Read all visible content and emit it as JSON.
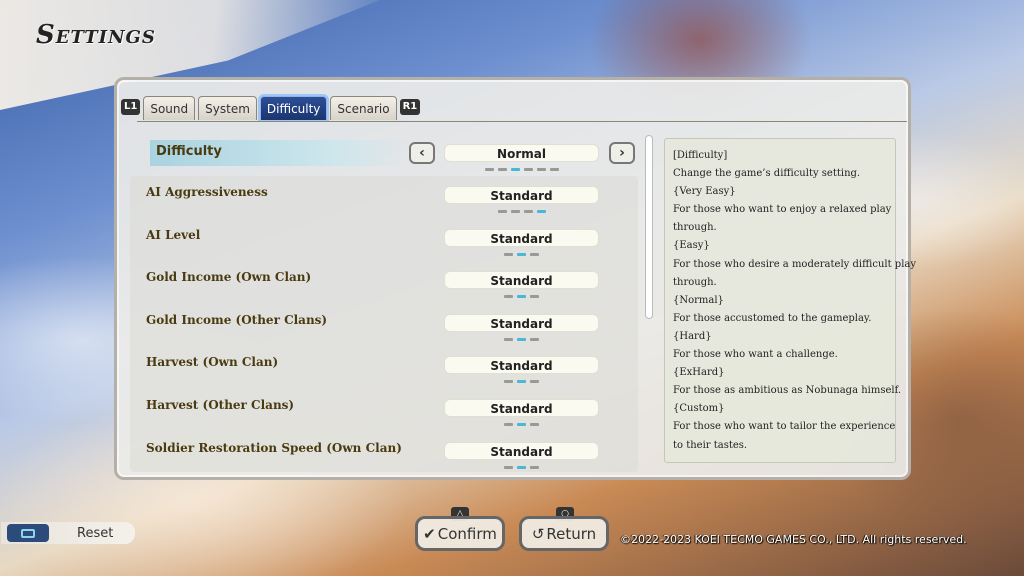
{
  "header": {
    "title": "Settings"
  },
  "tabs": {
    "left_shoulder": "L1",
    "right_shoulder": "R1",
    "items": [
      {
        "label": "Sound"
      },
      {
        "label": "System"
      },
      {
        "label": "Difficulty",
        "active": true
      },
      {
        "label": "Scenario"
      }
    ]
  },
  "difficulty": {
    "label": "Difficulty",
    "value": "Normal",
    "prev_icon": "chevron-left-icon",
    "next_icon": "chevron-right-icon",
    "level_index": 3,
    "level_count": 6
  },
  "options": [
    {
      "label": "AI Aggressiveness",
      "value": "Standard",
      "level_index": 4,
      "level_count": 4
    },
    {
      "label": "AI Level",
      "value": "Standard",
      "level_index": 2,
      "level_count": 3
    },
    {
      "label": "Gold Income (Own Clan)",
      "value": "Standard",
      "level_index": 2,
      "level_count": 3
    },
    {
      "label": "Gold Income (Other Clans)",
      "value": "Standard",
      "level_index": 2,
      "level_count": 3
    },
    {
      "label": "Harvest (Own Clan)",
      "value": "Standard",
      "level_index": 2,
      "level_count": 3
    },
    {
      "label": "Harvest (Other Clans)",
      "value": "Standard",
      "level_index": 2,
      "level_count": 3
    },
    {
      "label": "Soldier Restoration Speed (Own Clan)",
      "value": "Standard",
      "level_index": 2,
      "level_count": 3
    }
  ],
  "help": {
    "lines": [
      "[Difficulty]",
      "Change the game’s difficulty setting.",
      "{Very Easy}",
      "For those who want to enjoy a relaxed play",
      "through.",
      "{Easy}",
      "For those who desire a moderately difficult play",
      "through.",
      "{Normal}",
      "For those accustomed to the gameplay.",
      "{Hard}",
      "For those who want a challenge.",
      "{ExHard}",
      "For those as ambitious as Nobunaga himself.",
      "{Custom}",
      "For those who want to tailor the experience",
      "to their tastes."
    ]
  },
  "footer": {
    "reset_label": "Reset",
    "reset_icon": "touchpad-icon",
    "confirm_label": "Confirm",
    "confirm_hint": "△",
    "return_label": "Return",
    "return_hint": "○",
    "copyright": "©2022-2023 KOEI TECMO GAMES CO., LTD. All rights reserved."
  },
  "colors": {
    "accent_active_tab": "#1b3570",
    "dot_on": "#4bb7d8",
    "label_text": "#4a3a10"
  }
}
